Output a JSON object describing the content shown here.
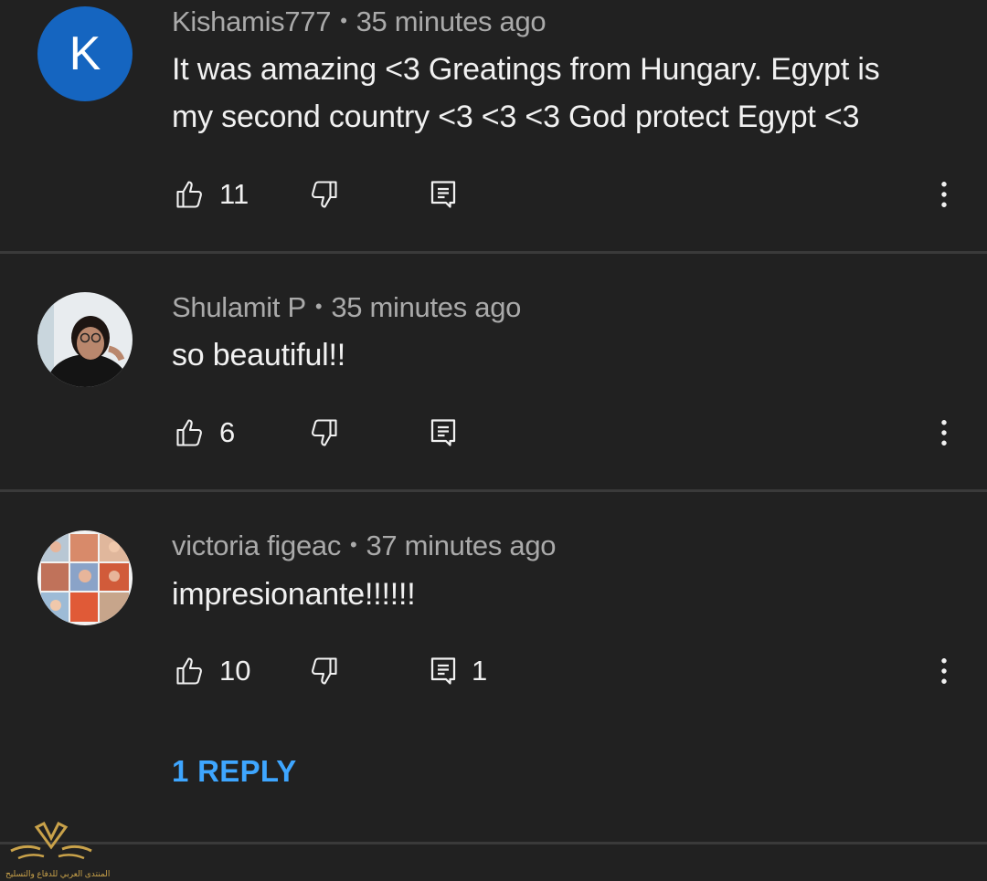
{
  "comments": [
    {
      "author": "Kishamis777",
      "time": "35 minutes ago",
      "avatar_letter": "K",
      "avatar_color": "#1565c0",
      "text_line1": "It was amazing <3 Greatings from Hungary. Egypt is",
      "text_line2": "my second country <3 <3 <3 God protect Egypt <3",
      "likes": "11",
      "replies": ""
    },
    {
      "author": "Shulamit P",
      "time": "35 minutes ago",
      "text": "so beautiful!!",
      "likes": "6",
      "replies": ""
    },
    {
      "author": "victoria figeac",
      "time": "37 minutes ago",
      "text": "impresionante!!!!!!",
      "likes": "10",
      "replies": "1"
    }
  ],
  "reply_link": "1 REPLY",
  "watermark_text": "المنتدى العربي للدفاع والتسليح",
  "colors": {
    "background": "#212121",
    "link": "#3ea6ff",
    "secondary_text": "#aaaaaa",
    "primary_text": "#f1f1f1"
  }
}
